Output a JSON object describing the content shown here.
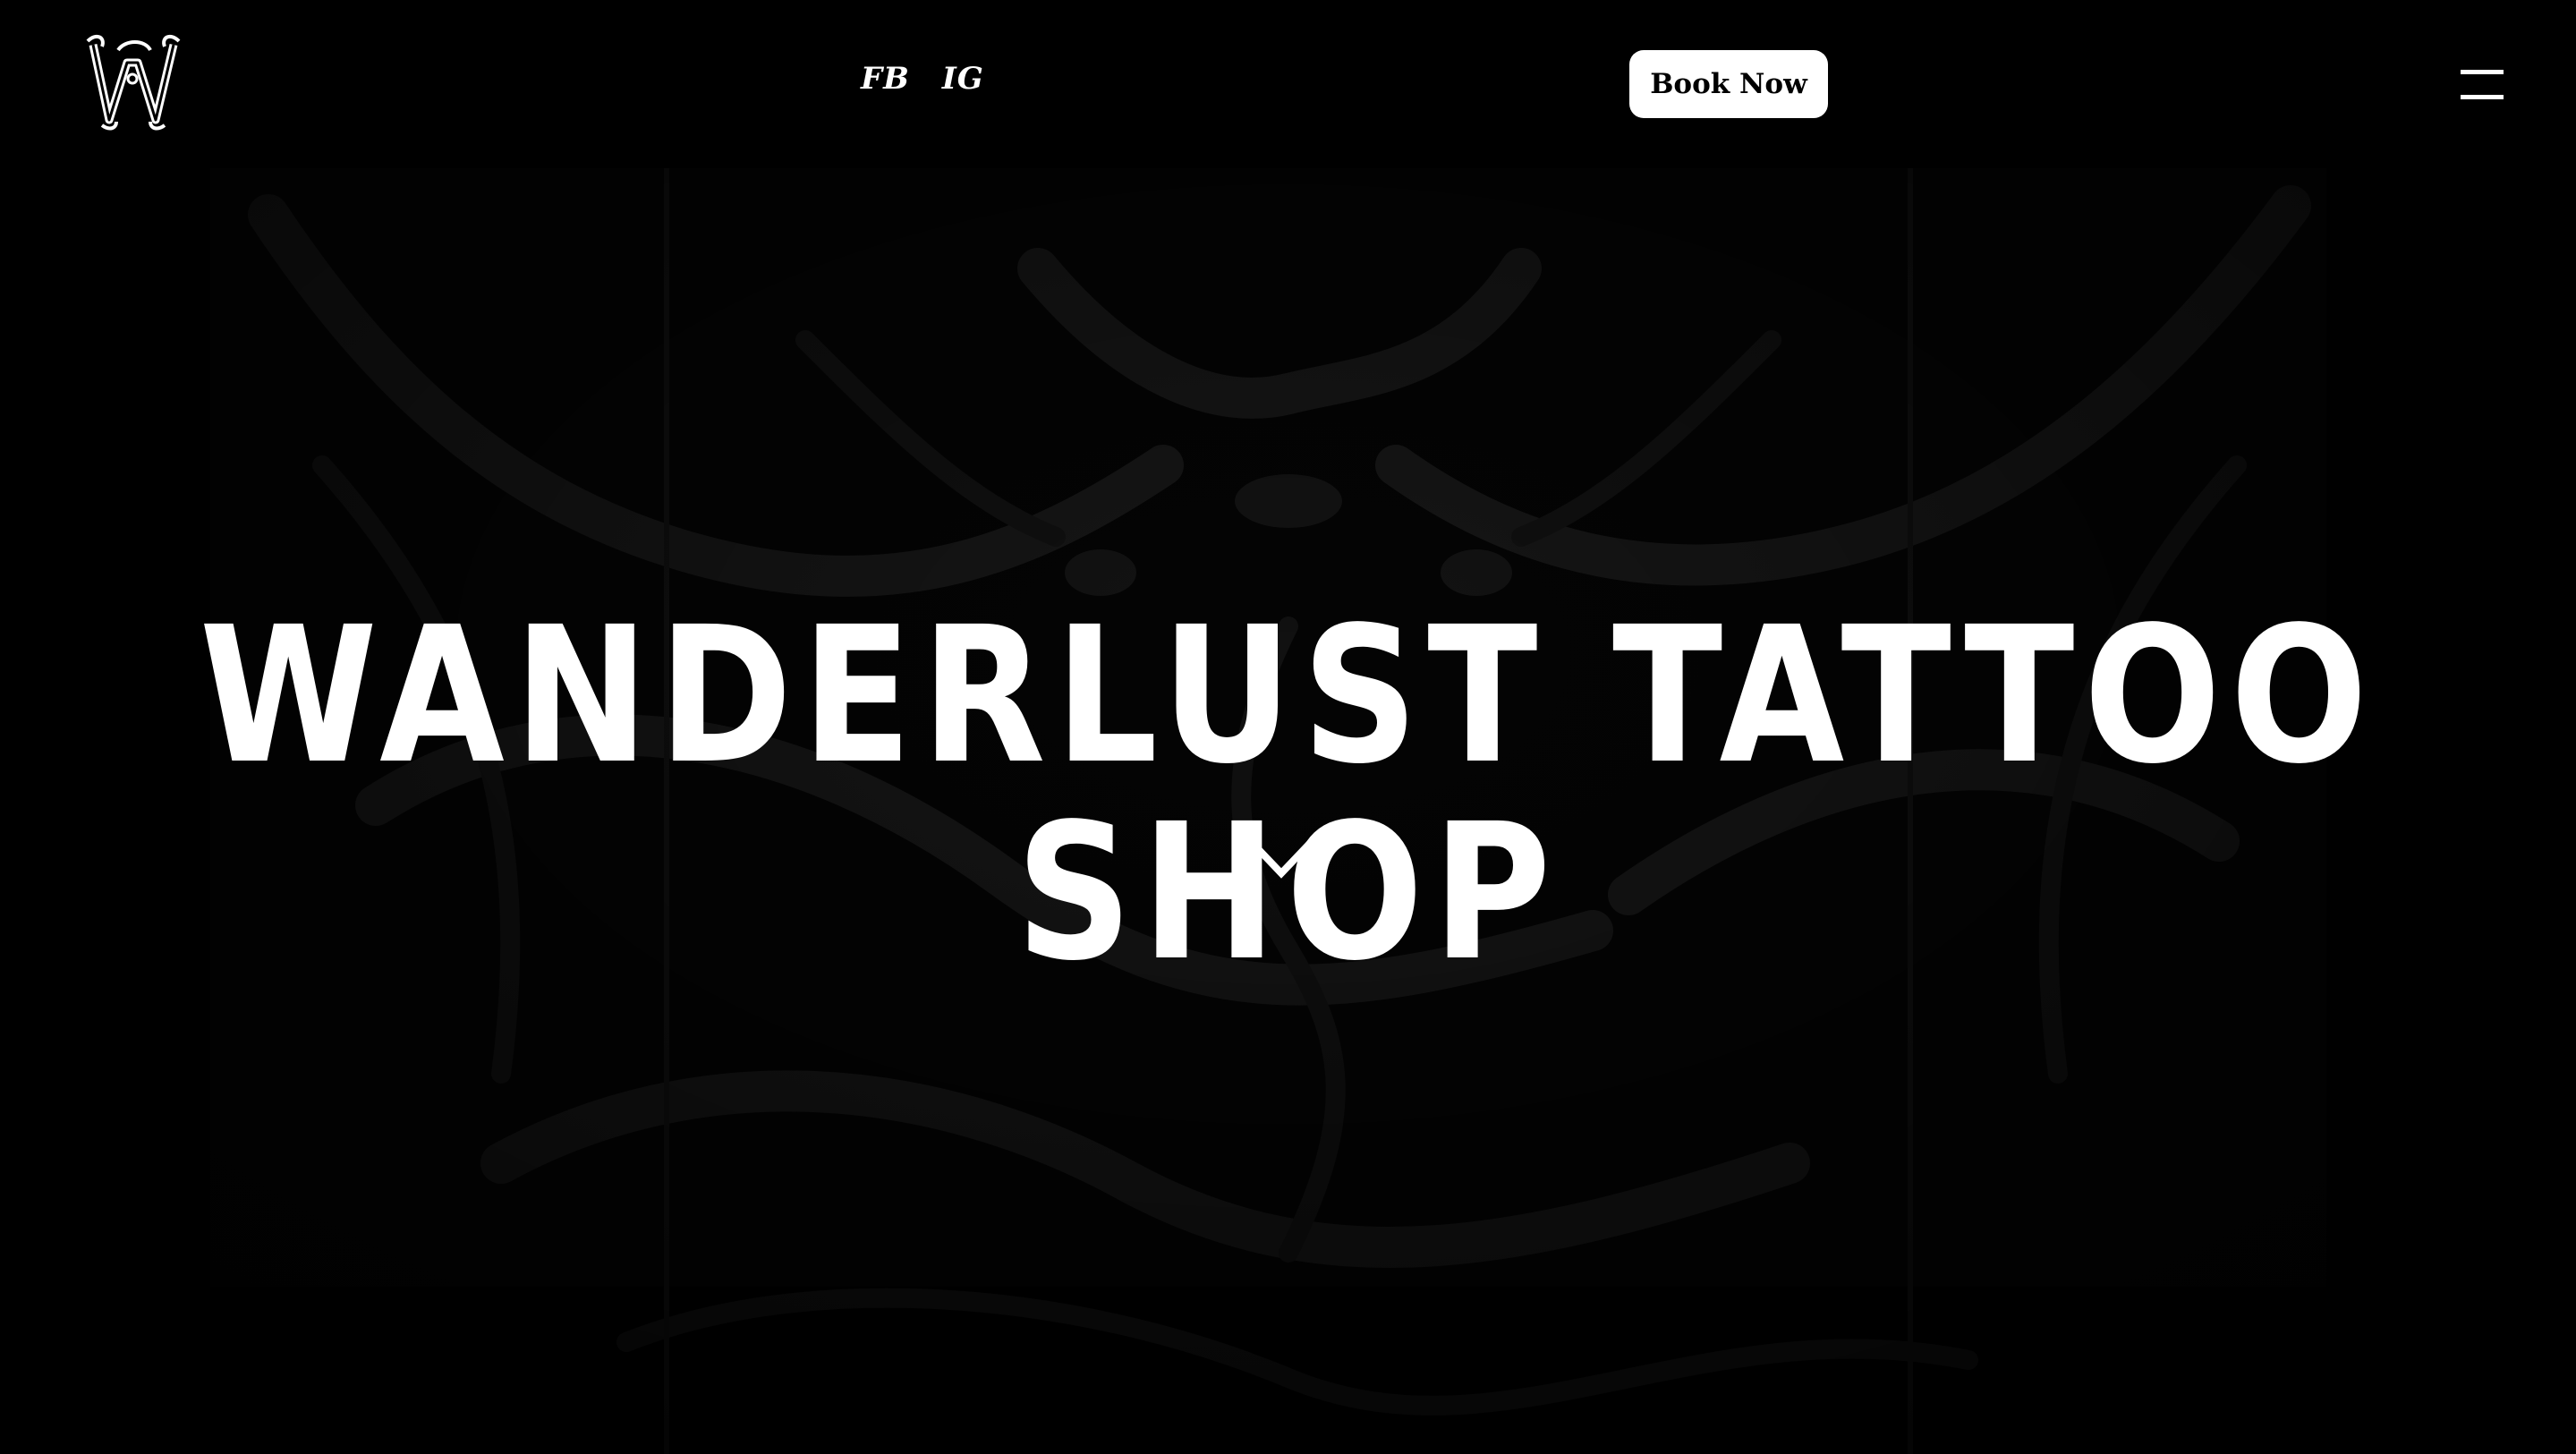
{
  "header": {
    "logo_icon": "w-monogram-logo-icon",
    "social": [
      {
        "label": "FB"
      },
      {
        "label": "IG"
      }
    ],
    "book_label": "Book Now",
    "menu_icon": "hamburger-menu-icon"
  },
  "hero": {
    "title": "WANDERLUST TATTOO SHOP",
    "scroll_icon": "chevron-down-icon"
  },
  "colors": {
    "background": "#000000",
    "text": "#ffffff",
    "button_bg": "#ffffff",
    "button_text": "#000000",
    "artwork": "#1a1a1a"
  }
}
